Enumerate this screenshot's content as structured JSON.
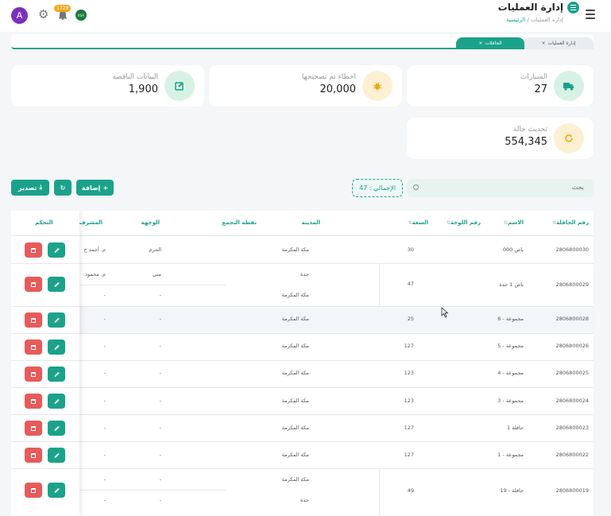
{
  "header": {
    "title": "إدارة العمليات",
    "breadcrumb_home": "الرئيسية",
    "breadcrumb_sep": "/",
    "breadcrumb_current": "إدارة العمليات",
    "avatar_letter": "A",
    "notification_count": "1729",
    "flag_text": "KSA"
  },
  "tabs": [
    {
      "label": "إدارة العمليات",
      "close": "×",
      "active": false
    },
    {
      "label": "الحافلات",
      "close": "×",
      "active": true
    }
  ],
  "stats": [
    {
      "label": "السيارات",
      "value": "27",
      "icon": "truck-icon",
      "color": "#1ba28a"
    },
    {
      "label": "اخطاء تم تصحيحها",
      "value": "20,000",
      "icon": "bug-icon",
      "color": "#f0a818"
    },
    {
      "label": "البيانات الناقصة",
      "value": "1,900",
      "icon": "edit-icon",
      "color": "#1ba28a"
    },
    {
      "label": "تحديث حالة",
      "value": "554,345",
      "icon": "refresh-icon",
      "color": "#f0a818"
    }
  ],
  "toolbar": {
    "search_placeholder": "بحث",
    "total_label": "الإجمالي : 47",
    "add_label": "إضافة",
    "add_icon": "+",
    "export_label": "تصدير",
    "export_icon": "⤓",
    "refresh_icon": "↻"
  },
  "table": {
    "headers": {
      "bus_no": "رقم الحافلة",
      "name": "الاسم",
      "plate": "رقم اللوحة",
      "capacity": "السعة",
      "city": "المدينة",
      "gathering": "نقطة التجمع",
      "destination": "الوجهة",
      "supervisor": "المشرف",
      "control": "التحكم",
      "sort_icon": "⇅"
    },
    "rows": [
      {
        "bus_no": "2806800030",
        "name": "باص 000",
        "capacity": "30",
        "city": "مكة المكرمة",
        "destination": "الحرم",
        "supervisor": "م. أحمد ح",
        "sub_city": "",
        "sub_dest": "",
        "sub_sup": ""
      },
      {
        "bus_no": "2806800029",
        "name": "باص 1 جدة",
        "capacity": "47",
        "city": "جدة",
        "destination": "منى",
        "supervisor": "م. محمود",
        "sub_city": "مكة المكرمة",
        "sub_dest": "-",
        "sub_sup": "-"
      },
      {
        "bus_no": "2806800028",
        "name": "مجموعة - 6",
        "capacity": "25",
        "city": "مكة المكرمة",
        "destination": "-",
        "supervisor": "-",
        "sub_city": "",
        "sub_dest": "",
        "sub_sup": ""
      },
      {
        "bus_no": "2806800026",
        "name": "مجموعة - 5",
        "capacity": "127",
        "city": "مكة المكرمة",
        "destination": "-",
        "supervisor": "-",
        "sub_city": "",
        "sub_dest": "",
        "sub_sup": ""
      },
      {
        "bus_no": "2806800025",
        "name": "مجموعة - 4",
        "capacity": "123",
        "city": "مكة المكرمة",
        "destination": "-",
        "supervisor": "-",
        "sub_city": "",
        "sub_dest": "",
        "sub_sup": ""
      },
      {
        "bus_no": "2806800024",
        "name": "مجموعة - 3",
        "capacity": "123",
        "city": "مكة المكرمة",
        "destination": "-",
        "supervisor": "-",
        "sub_city": "",
        "sub_dest": "",
        "sub_sup": ""
      },
      {
        "bus_no": "2806800023",
        "name": "حافلة 1",
        "capacity": "127",
        "city": "مكة المكرمة",
        "destination": "-",
        "supervisor": "-",
        "sub_city": "",
        "sub_dest": "",
        "sub_sup": ""
      },
      {
        "bus_no": "2806800022",
        "name": "مجموعة - 1",
        "capacity": "127",
        "city": "مكة المكرمة",
        "destination": "-",
        "supervisor": "-",
        "sub_city": "",
        "sub_dest": "",
        "sub_sup": ""
      },
      {
        "bus_no": "2806800019",
        "name": "حافلة - 19",
        "capacity": "49",
        "city": "مكة المكرمة",
        "destination": "-",
        "supervisor": "-",
        "sub_city": "جدة",
        "sub_dest": "-",
        "sub_sup": "-"
      }
    ]
  }
}
